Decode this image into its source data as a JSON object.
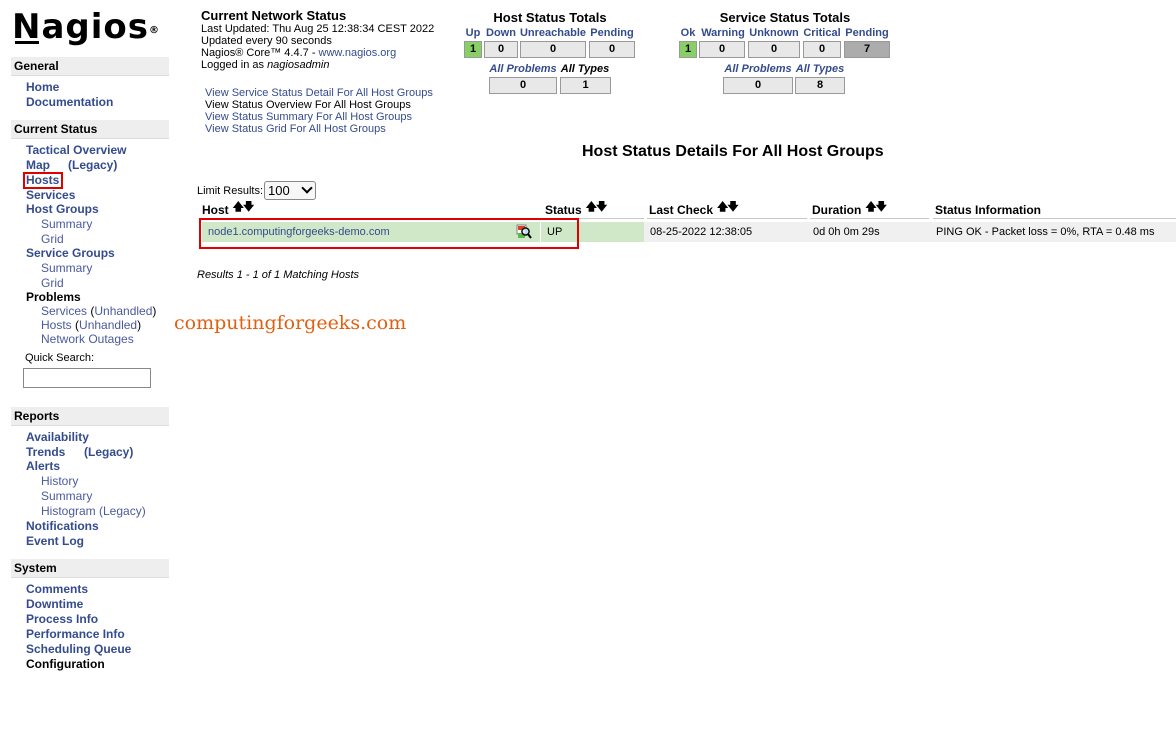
{
  "logo": {
    "text": "Nagios",
    "mark": "®"
  },
  "sidebar": {
    "general": {
      "title": "General",
      "items": [
        "Home",
        "Documentation"
      ]
    },
    "current_status": {
      "title": "Current Status",
      "tactical_overview": "Tactical Overview",
      "map": "Map",
      "map_legacy": "(Legacy)",
      "hosts": "Hosts",
      "services": "Services",
      "host_groups": "Host Groups",
      "hg_summary": "Summary",
      "hg_grid": "Grid",
      "service_groups": "Service Groups",
      "sg_summary": "Summary",
      "sg_grid": "Grid",
      "problems": "Problems",
      "prob_services": "Services",
      "prob_services_unhandled": "Unhandled",
      "prob_hosts": "Hosts",
      "prob_hosts_unhandled": "Unhandled",
      "network_outages": "Network Outages",
      "quick_search_label": "Quick Search:"
    },
    "reports": {
      "title": "Reports",
      "availability": "Availability",
      "trends": "Trends",
      "trends_legacy": "(Legacy)",
      "alerts": "Alerts",
      "history": "History",
      "summary": "Summary",
      "histogram": "Histogram (Legacy)",
      "notifications": "Notifications",
      "event_log": "Event Log"
    },
    "system": {
      "title": "System",
      "comments": "Comments",
      "downtime": "Downtime",
      "process_info": "Process Info",
      "performance_info": "Performance Info",
      "scheduling_queue": "Scheduling Queue",
      "configuration": "Configuration"
    }
  },
  "network_status": {
    "title": "Current Network Status",
    "last_updated": "Last Updated: Thu Aug 25 12:38:34 CEST 2022",
    "update_interval": "Updated every 90 seconds",
    "version_prefix": "Nagios® Core™ 4.4.7 - ",
    "version_link": "www.nagios.org",
    "logged_in_prefix": "Logged in as ",
    "user": "nagiosadmin"
  },
  "view_links": [
    "View Service Status Detail For All Host Groups",
    "View Status Overview For All Host Groups",
    "View Status Summary For All Host Groups",
    "View Status Grid For All Host Groups"
  ],
  "host_totals": {
    "title": "Host Status Totals",
    "labels": [
      "Up",
      "Down",
      "Unreachable",
      "Pending"
    ],
    "values": [
      "1",
      "0",
      "0",
      "0"
    ],
    "all_problems_label": "All Problems",
    "all_types_label": "All Types",
    "all_problems": "0",
    "all_types": "1"
  },
  "service_totals": {
    "title": "Service Status Totals",
    "labels": [
      "Ok",
      "Warning",
      "Unknown",
      "Critical",
      "Pending"
    ],
    "values": [
      "1",
      "0",
      "0",
      "0",
      "7"
    ],
    "all_problems_label": "All Problems",
    "all_types_label": "All Types",
    "all_problems": "0",
    "all_types": "8"
  },
  "main": {
    "title": "Host Status Details For All Host Groups",
    "limit_label": "Limit Results:",
    "limit_value": "100",
    "columns": [
      "Host",
      "Status",
      "Last Check",
      "Duration",
      "Status Information"
    ],
    "sort_arrows": "🡅🡇",
    "rows": [
      {
        "host": "node1.computingforgeeks-demo.com",
        "status": "UP",
        "last_check": "08-25-2022 12:38:05",
        "duration": "0d 0h 0m 29s",
        "info": "PING OK - Packet loss = 0%, RTA = 0.48 ms"
      }
    ],
    "results": "Results 1 - 1 of 1 Matching Hosts"
  },
  "watermark": "computingforgeeks.com",
  "colors": {
    "link": "#344b8e",
    "ok_green": "#88d066",
    "row_green": "#d0e8c8",
    "highlight_red": "#e00000",
    "watermark": "#e06010"
  }
}
